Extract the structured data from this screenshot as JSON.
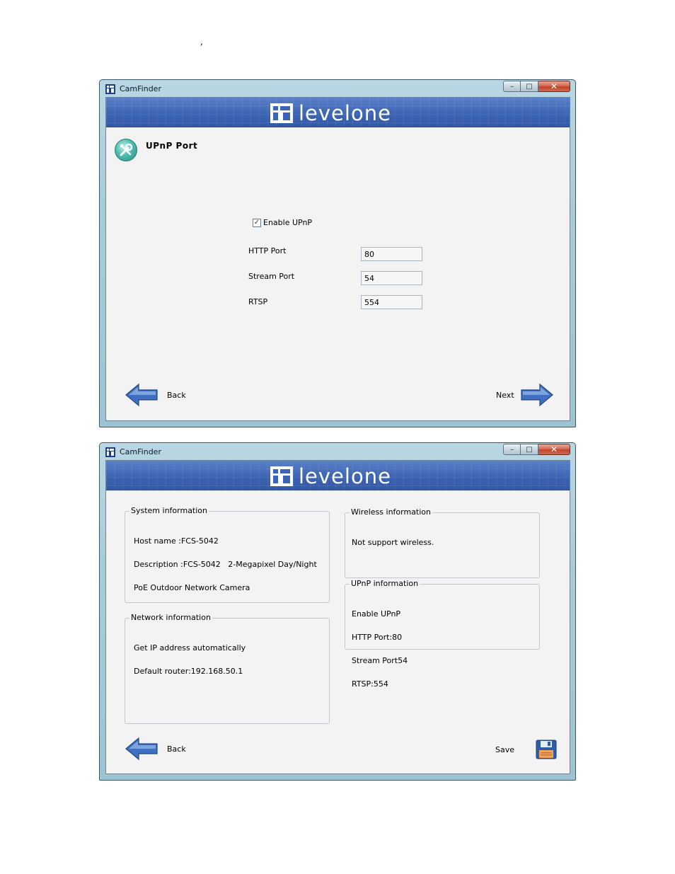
{
  "page": {
    "stray_mark": ","
  },
  "windows": {
    "upnp": {
      "title": "CamFinder",
      "brand": "levelone",
      "controls": {
        "minimize": "–",
        "maximize": "□",
        "close": "✕"
      },
      "page_title": "UPnP  Port",
      "page_icon": "tools-icon",
      "enable_upnp": {
        "label": "Enable UPnP",
        "checked": true
      },
      "fields": {
        "http_port": {
          "label": "HTTP Port",
          "value": "80"
        },
        "stream_port": {
          "label": "Stream Port",
          "value": "54"
        },
        "rtsp": {
          "label": "RTSP",
          "value": "554"
        }
      },
      "back_label": "Back",
      "next_label": "Next"
    },
    "summary": {
      "title": "CamFinder",
      "brand": "levelone",
      "controls": {
        "minimize": "–",
        "maximize": "□",
        "close": "✕"
      },
      "system": {
        "legend": "System information",
        "lines": [
          "Host name :FCS-5042",
          "Description :FCS-5042   2-Megapixel Day/Night",
          "PoE Outdoor Network Camera"
        ]
      },
      "network": {
        "legend": "Network information",
        "lines": [
          "Get IP address automatically",
          "Default router:192.168.50.1"
        ]
      },
      "wireless": {
        "legend": "Wireless information",
        "lines": [
          "Not support wireless."
        ]
      },
      "upnp": {
        "legend": "UPnP information",
        "lines": [
          "Enable UPnP",
          "HTTP Port:80",
          "Stream Port54",
          "RTSP:554"
        ]
      },
      "back_label": "Back",
      "save_label": "Save"
    }
  },
  "colors": {
    "banner": "#3c64b4",
    "frame": "#a8cbd9",
    "client": "#f3f3f3",
    "arrow": "#3f6fc0"
  }
}
